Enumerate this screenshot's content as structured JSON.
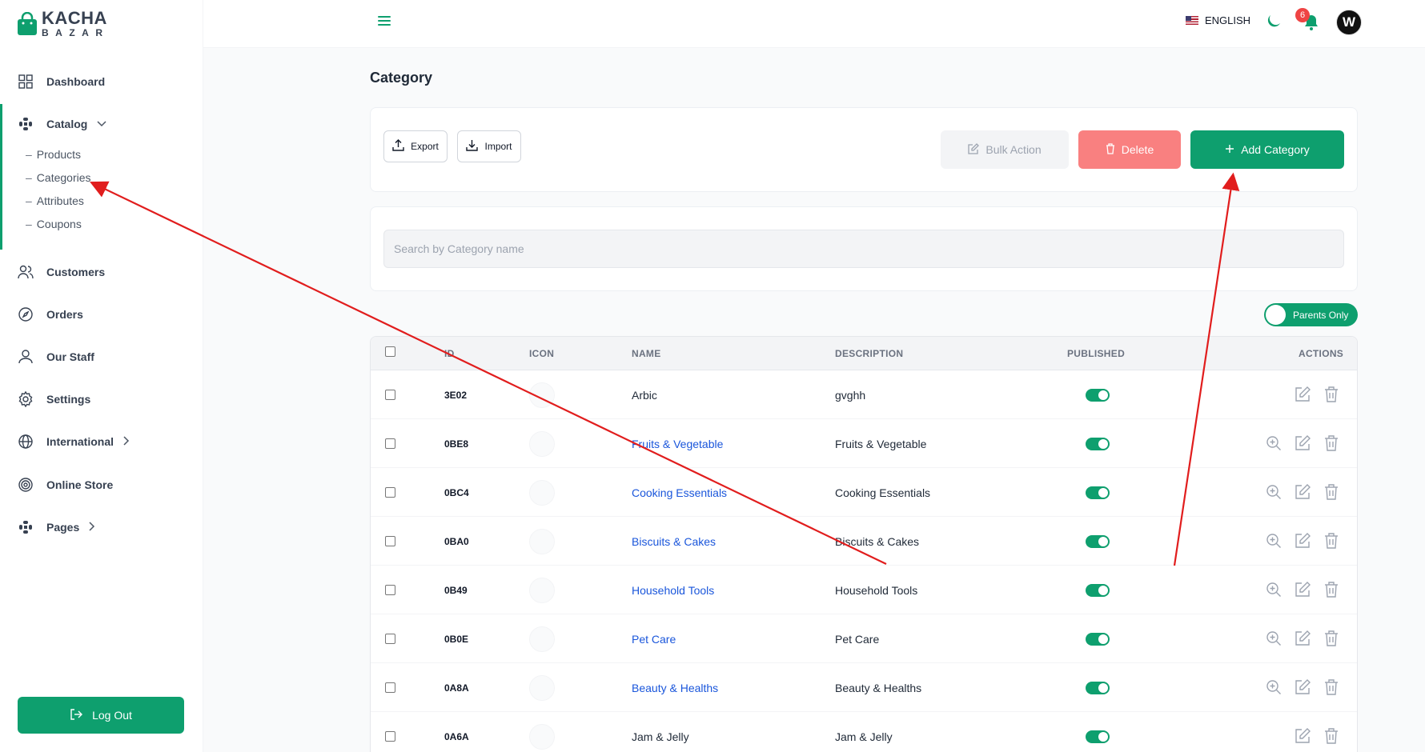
{
  "brand": {
    "line1": "KACHA",
    "line2": "BAZAR"
  },
  "sidebar": {
    "dashboard": "Dashboard",
    "catalog": "Catalog",
    "catalog_items": [
      "Products",
      "Categories",
      "Attributes",
      "Coupons"
    ],
    "customers": "Customers",
    "orders": "Orders",
    "our_staff": "Our Staff",
    "settings": "Settings",
    "international": "International",
    "online_store": "Online Store",
    "pages": "Pages",
    "logout": "Log Out"
  },
  "header": {
    "language": "ENGLISH",
    "notification_count": "6",
    "avatar_initial": "W"
  },
  "page": {
    "title": "Category",
    "export": "Export",
    "import": "Import",
    "bulk_action": "Bulk Action",
    "delete": "Delete",
    "add_category": "Add Category",
    "search_placeholder": "Search by Category name",
    "parents_only": "Parents Only"
  },
  "table": {
    "headers": {
      "id": "ID",
      "icon": "ICON",
      "name": "NAME",
      "description": "DESCRIPTION",
      "published": "PUBLISHED",
      "actions": "ACTIONS"
    },
    "rows": [
      {
        "id": "3E02",
        "name": "Arbic",
        "description": "gvghh",
        "published": true,
        "has_children": false
      },
      {
        "id": "0BE8",
        "name": "Fruits & Vegetable",
        "description": "Fruits & Vegetable",
        "published": true,
        "has_children": true
      },
      {
        "id": "0BC4",
        "name": "Cooking Essentials",
        "description": "Cooking Essentials",
        "published": true,
        "has_children": true
      },
      {
        "id": "0BA0",
        "name": "Biscuits & Cakes",
        "description": "Biscuits & Cakes",
        "published": true,
        "has_children": true
      },
      {
        "id": "0B49",
        "name": "Household Tools",
        "description": "Household Tools",
        "published": true,
        "has_children": true
      },
      {
        "id": "0B0E",
        "name": "Pet Care",
        "description": "Pet Care",
        "published": true,
        "has_children": true
      },
      {
        "id": "0A8A",
        "name": "Beauty & Healths",
        "description": "Beauty & Healths",
        "published": true,
        "has_children": true
      },
      {
        "id": "0A6A",
        "name": "Jam & Jelly",
        "description": "Jam & Jelly",
        "published": true,
        "has_children": false
      }
    ]
  },
  "colors": {
    "accent": "#0e9f6e",
    "danger": "#f98080",
    "link": "#1a56db",
    "annotation": "#e11d1d"
  }
}
